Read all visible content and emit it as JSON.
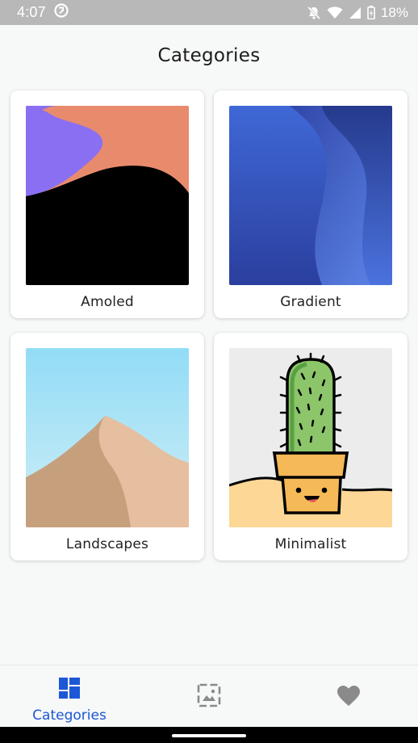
{
  "status_bar": {
    "time": "4:07",
    "battery": "18%"
  },
  "page": {
    "title": "Categories"
  },
  "categories": [
    {
      "label": "Amoled"
    },
    {
      "label": "Gradient"
    },
    {
      "label": "Landscapes"
    },
    {
      "label": "Minimalist"
    }
  ],
  "bottom_nav": {
    "items": [
      {
        "label": "Categories",
        "icon": "dashboard-icon",
        "active": true
      },
      {
        "label": "",
        "icon": "image-icon",
        "active": false
      },
      {
        "label": "",
        "icon": "heart-icon",
        "active": false
      }
    ],
    "active_color": "#1c57d6",
    "inactive_color": "#8a8a8a"
  }
}
